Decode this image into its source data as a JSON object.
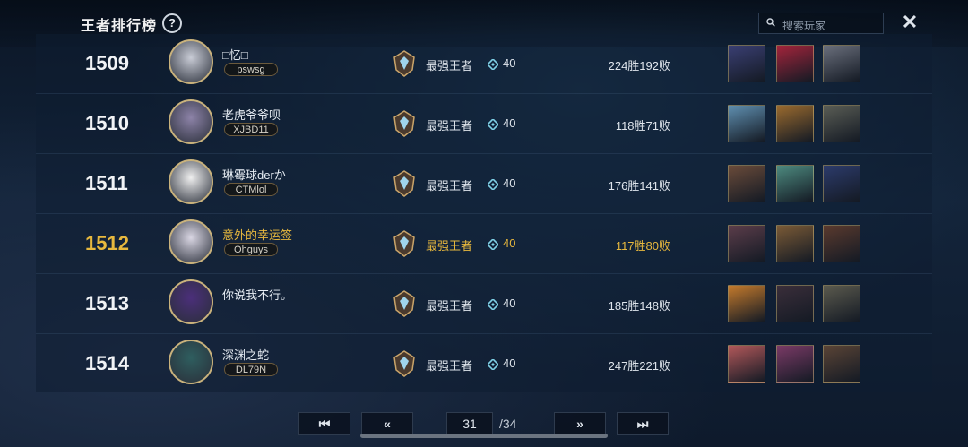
{
  "header": {
    "title": "王者排行榜",
    "help_label": "?",
    "search_placeholder": "搜索玩家",
    "close_label": "✕"
  },
  "rows": [
    {
      "rank": "1509",
      "name": "□忆□",
      "tag": "pswsg",
      "tier": "最强王者",
      "points": "40",
      "record": "224胜192败",
      "highlight": false,
      "avatar_color": "#c9ccd6",
      "heroes": [
        "#3a3f73",
        "#a3243b",
        "#6a6f7c"
      ]
    },
    {
      "rank": "1510",
      "name": "老虎爷爷呗",
      "tag": "XJBD11",
      "tier": "最强王者",
      "points": "40",
      "record": "118胜71败",
      "highlight": false,
      "avatar_color": "#8d83a8",
      "heroes": [
        "#5f8fb0",
        "#9a6a2e",
        "#5a5d55"
      ]
    },
    {
      "rank": "1511",
      "name": "琳霉球derか",
      "tag": "CTMlol",
      "tier": "最强王者",
      "points": "40",
      "record": "176胜141败",
      "highlight": false,
      "avatar_color": "#efefef",
      "heroes": [
        "#6a4b3a",
        "#4d8a7f",
        "#2c3b6b"
      ]
    },
    {
      "rank": "1512",
      "name": "意外的幸运签",
      "tag": "Ohguys",
      "tier": "最强王者",
      "points": "40",
      "record": "117胜80败",
      "highlight": true,
      "avatar_color": "#d9d6e3",
      "heroes": [
        "#5b3d4a",
        "#7a5a36",
        "#5a3a2e"
      ]
    },
    {
      "rank": "1513",
      "name": "你说我不行。",
      "tag": "",
      "tier": "最强王者",
      "points": "40",
      "record": "185胜148败",
      "highlight": false,
      "avatar_color": "#4b2f7a",
      "heroes": [
        "#c47a2c",
        "#3a2e3a",
        "#5b5a4e"
      ]
    },
    {
      "rank": "1514",
      "name": "深渊之蛇",
      "tag": "DL79N",
      "tier": "最强王者",
      "points": "40",
      "record": "247胜221败",
      "highlight": false,
      "avatar_color": "#2f5e5f",
      "heroes": [
        "#b2585a",
        "#7a3a66",
        "#5a4436"
      ]
    }
  ],
  "pager": {
    "first_label": "⏮",
    "prev_label": "«",
    "current_page": "31",
    "total": "/34",
    "next_label": "»",
    "last_label": "⏭"
  },
  "colors": {
    "highlight": "#e7b83e",
    "accent_points": "#7fd0e6"
  }
}
